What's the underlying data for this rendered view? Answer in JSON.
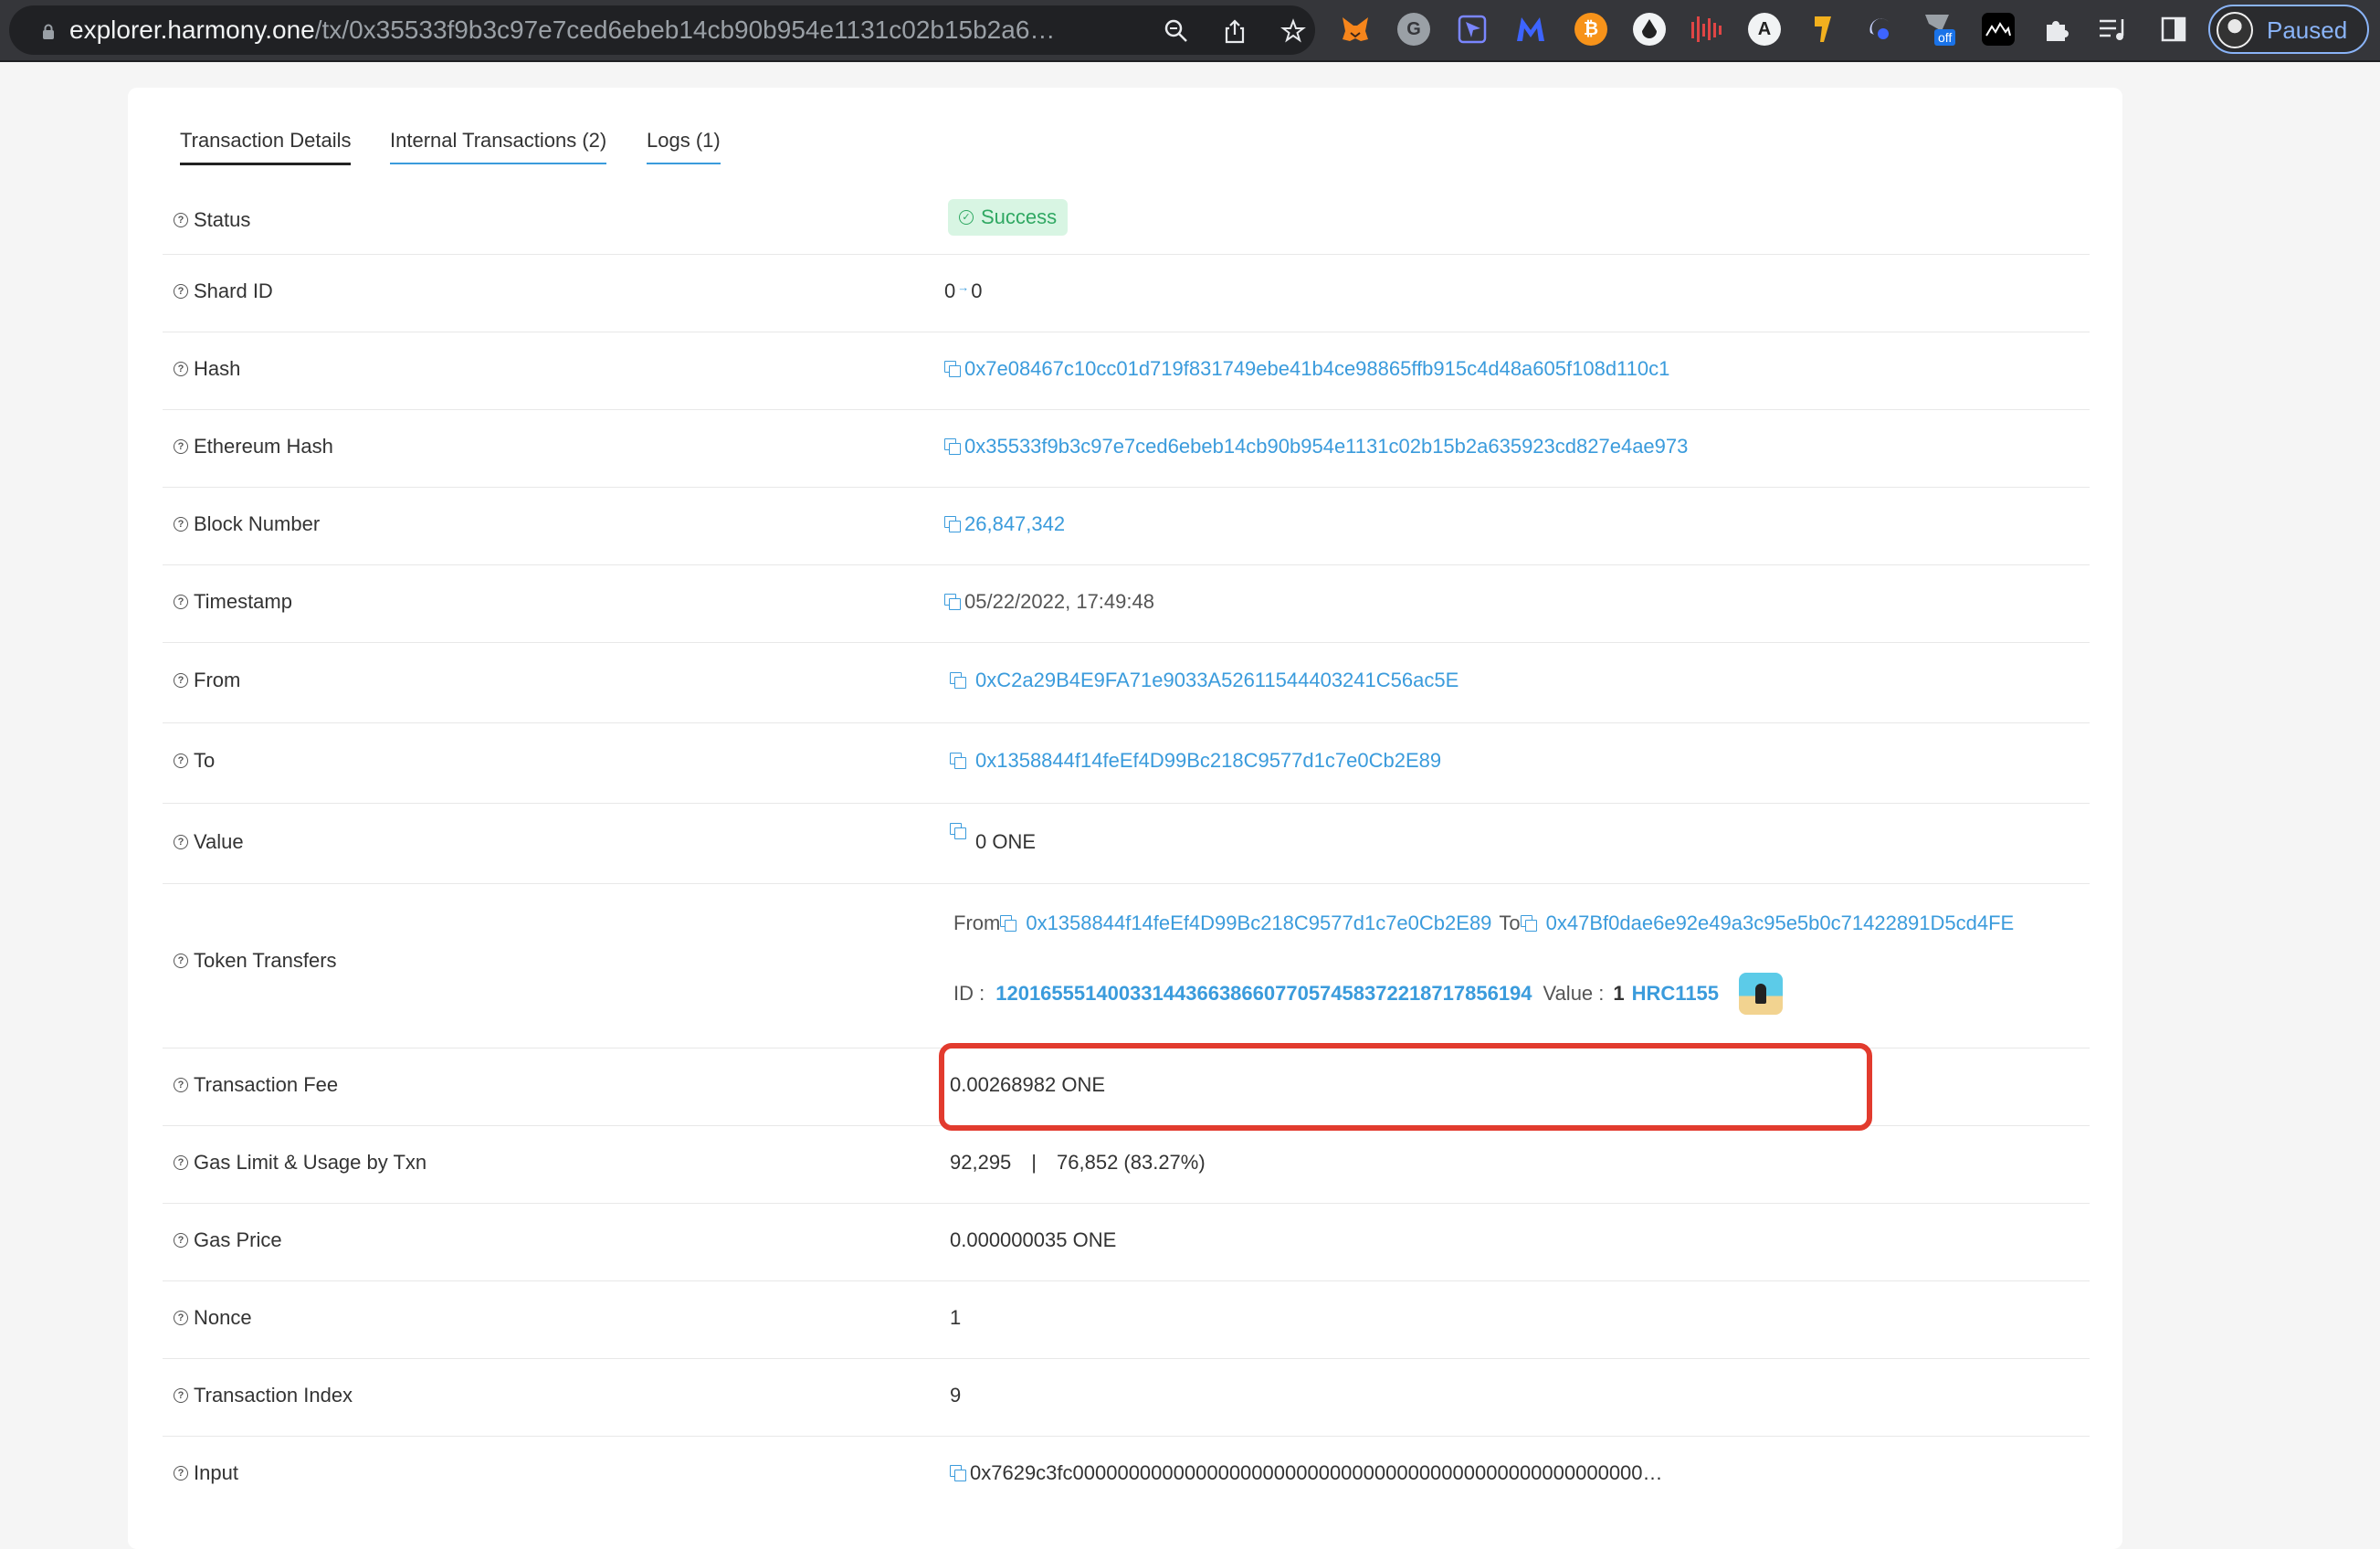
{
  "browser": {
    "url_host": "explorer.harmony.one",
    "url_path": "/tx/0x35533f9b3c97e7ced6ebeb14cb90b954e1131c02b15b2a6…",
    "profile_label": "Paused",
    "extension_off_badge": "off"
  },
  "tabs": [
    {
      "label": "Transaction Details"
    },
    {
      "label": "Internal Transactions (2)"
    },
    {
      "label": "Logs (1)"
    }
  ],
  "rows": {
    "status": {
      "label": "Status",
      "value": "Success"
    },
    "shard": {
      "label": "Shard ID",
      "from": "0",
      "to": "0"
    },
    "hash": {
      "label": "Hash",
      "value": "0x7e08467c10cc01d719f831749ebe41b4ce98865ffb915c4d48a605f108d110c1"
    },
    "eth_hash": {
      "label": "Ethereum Hash",
      "value": "0x35533f9b3c97e7ced6ebeb14cb90b954e1131c02b15b2a635923cd827e4ae973"
    },
    "block": {
      "label": "Block Number",
      "value": "26,847,342"
    },
    "timestamp": {
      "label": "Timestamp",
      "value": "05/22/2022, 17:49:48"
    },
    "from": {
      "label": "From",
      "value": "0xC2a29B4E9FA71e9033A52611544403241C56ac5E"
    },
    "to": {
      "label": "To",
      "value": "0x1358844f14feEf4D99Bc218C9577d1c7e0Cb2E89"
    },
    "value": {
      "label": "Value",
      "value": "0 ONE"
    },
    "token_transfers": {
      "label": "Token Transfers",
      "from_label": "From",
      "from_address": "0x1358844f14feEf4D99Bc218C9577d1c7e0Cb2E89",
      "to_label": "To",
      "to_address": "0x47Bf0dae6e92e49a3c95e5b0c71422891D5cd4FE",
      "id_label": "ID :",
      "token_id": "120165551400331443663866077057458372218717856194",
      "value_label": "Value :",
      "value_amount": "1",
      "token_standard": "HRC1155"
    },
    "fee": {
      "label": "Transaction Fee",
      "value": "0.00268982 ONE"
    },
    "gas": {
      "label": "Gas Limit & Usage by Txn",
      "limit": "92,295",
      "separator": "|",
      "usage": "76,852 (83.27%)"
    },
    "gas_price": {
      "label": "Gas Price",
      "value": "0.000000035 ONE"
    },
    "nonce": {
      "label": "Nonce",
      "value": "1"
    },
    "tx_index": {
      "label": "Transaction Index",
      "value": "9"
    },
    "input": {
      "label": "Input",
      "value": "0x7629c3fc000000000000000000000000000000000000000000000000000…"
    }
  },
  "colors": {
    "link": "#3a9bdc",
    "success_bg": "#d8f5e3",
    "success_text": "#2fa862",
    "highlight_border": "#e23b2e"
  }
}
